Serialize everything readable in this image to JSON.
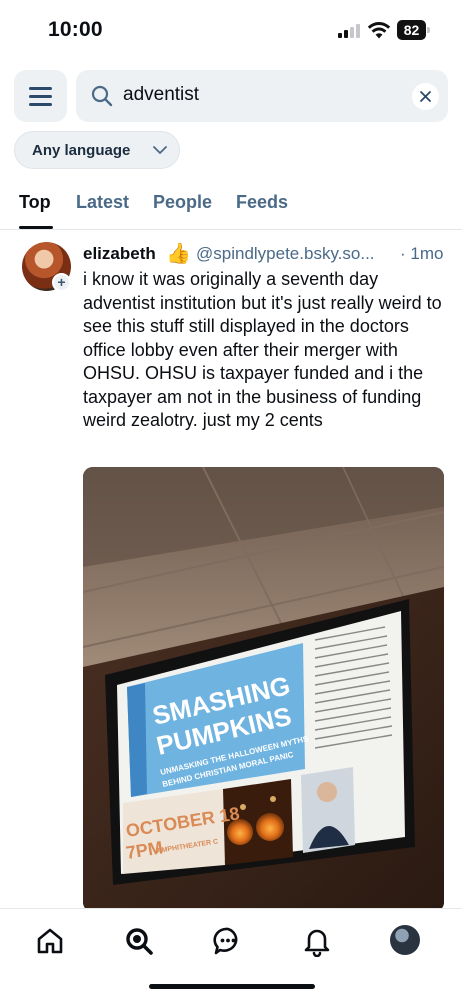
{
  "status_bar": {
    "time": "10:00",
    "battery": "82"
  },
  "header": {
    "menu_icon": "hamburger-menu-icon",
    "search": {
      "value": "adventist",
      "placeholder": "Search",
      "icon": "search-icon",
      "clear_icon": "close-icon"
    },
    "language_filter": {
      "selected": "Any language",
      "icon": "chevron-down-icon"
    }
  },
  "tabs": [
    {
      "label": "Top",
      "active": true
    },
    {
      "label": "Latest",
      "active": false
    },
    {
      "label": "People",
      "active": false
    },
    {
      "label": "Feeds",
      "active": false
    }
  ],
  "post": {
    "author_name": "elizabeth",
    "author_emoji": "👍",
    "handle": "@spindlypete.bsky.so...",
    "time": "· 1mo",
    "text": "i know it was originally a seventh day adventist institution but it's just really weird to see this stuff still displayed in the doctors office lobby even after their merger with OHSU. OHSU is taxpayer funded and i the taxpayer am not in the business of funding weird zealotry. just my 2 cents",
    "image": {
      "screen_title_1": "SMASHING",
      "screen_title_2": "PUMPKINS",
      "screen_subtitle_1": "UNMASKING THE HALLOWEEN MYTHS",
      "screen_subtitle_2": "BEHIND CHRISTIAN MORAL PANIC",
      "screen_date": "OCTOBER 18",
      "screen_time": "7PM",
      "screen_venue": "AMPHITHEATER C",
      "screen_body": "Halloween is arguably the most controversial holiday in America for Christians. Each year, tales of terror go screaming through faith communities, warning believers of the diabolical dangers that threaten those who dare celebrate. But are these dark parables true? How should we respond? Mentor and religion researcher Seth Pierce, Ph.D., looks at three Halloween legends and what they tell us about ourselves, our society and God."
    }
  },
  "bottom_nav": [
    {
      "icon": "home-icon"
    },
    {
      "icon": "search-icon"
    },
    {
      "icon": "chat-icon"
    },
    {
      "icon": "notifications-bell-icon"
    },
    {
      "icon": "profile-avatar"
    }
  ]
}
